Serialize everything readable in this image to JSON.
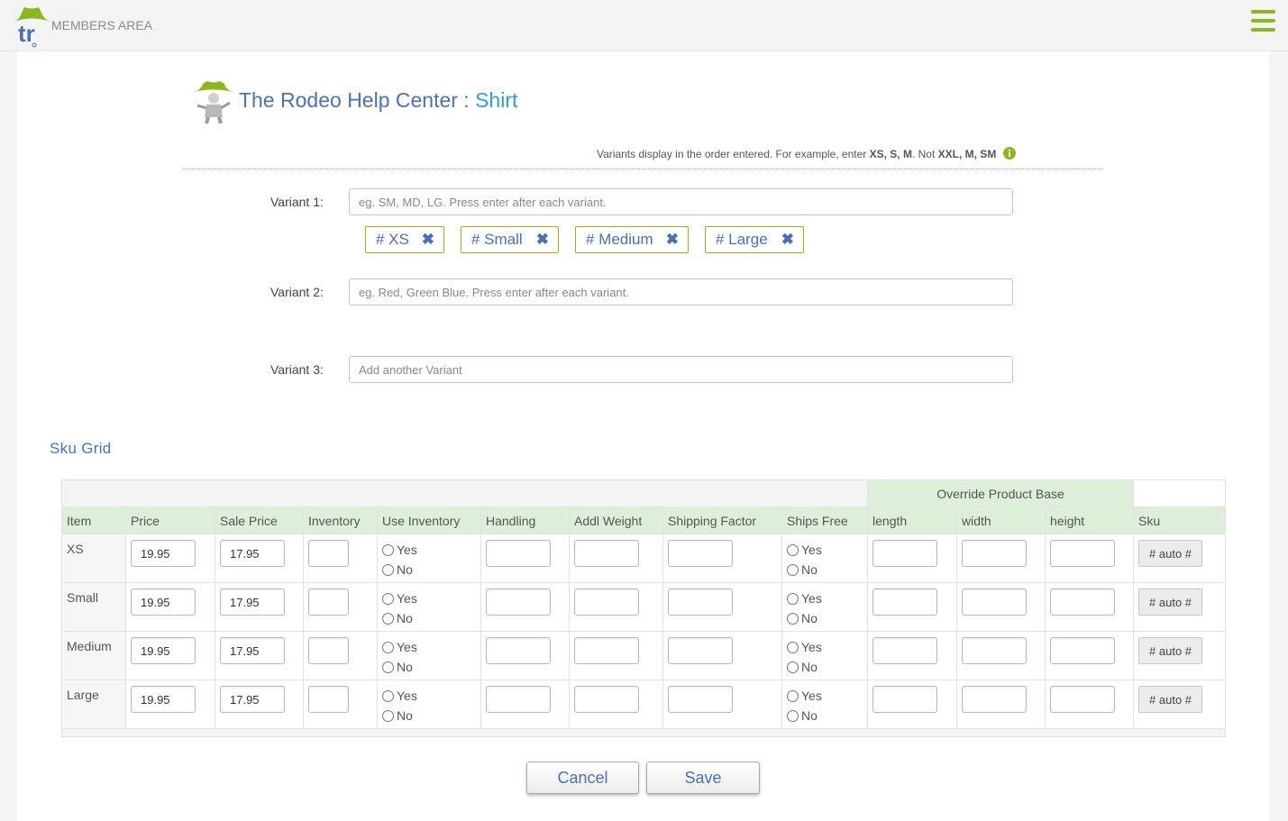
{
  "header": {
    "logo_text": "tr",
    "members_label": "MEMBERS AREA",
    "accent_color": "#8cb81e"
  },
  "page": {
    "title_main": "The Rodeo Help Center : ",
    "title_sub": "Shirt",
    "hint_text_1": "Variants display in the order entered. For example, enter ",
    "hint_bold_1": "XS, S, M",
    "hint_text_2": ". Not ",
    "hint_bold_2": "XXL, M, SM"
  },
  "variants": {
    "variant1": {
      "label": "Variant 1:",
      "placeholder": "eg. SM, MD, LG. Press enter after each variant.",
      "value": ""
    },
    "tags": [
      {
        "label": "# XS"
      },
      {
        "label": "# Small"
      },
      {
        "label": "# Medium"
      },
      {
        "label": "# Large"
      }
    ],
    "tag_remove_glyph": "✖",
    "variant2": {
      "label": "Variant 2:",
      "placeholder": "eg. Red, Green Blue. Press enter after each variant.",
      "value": ""
    },
    "variant3": {
      "label": "Variant 3:",
      "placeholder": "Add another Variant",
      "value": ""
    }
  },
  "sku_grid": {
    "title": "Sku Grid",
    "override_header": "Override Product Base",
    "columns": [
      "Item",
      "Price",
      "Sale Price",
      "Inventory",
      "Use Inventory",
      "Handling",
      "Addl Weight",
      "Shipping Factor",
      "Ships Free",
      "length",
      "width",
      "height",
      "Sku"
    ],
    "yes_label": "Yes",
    "no_label": "No",
    "sku_button": "# auto #",
    "rows": [
      {
        "item": "XS",
        "price": "19.95",
        "sale_price": "17.95"
      },
      {
        "item": "Small",
        "price": "19.95",
        "sale_price": "17.95"
      },
      {
        "item": "Medium",
        "price": "19.95",
        "sale_price": "17.95"
      },
      {
        "item": "Large",
        "price": "19.95",
        "sale_price": "17.95"
      }
    ]
  },
  "actions": {
    "cancel_label": "Cancel",
    "save_label": "Save"
  }
}
